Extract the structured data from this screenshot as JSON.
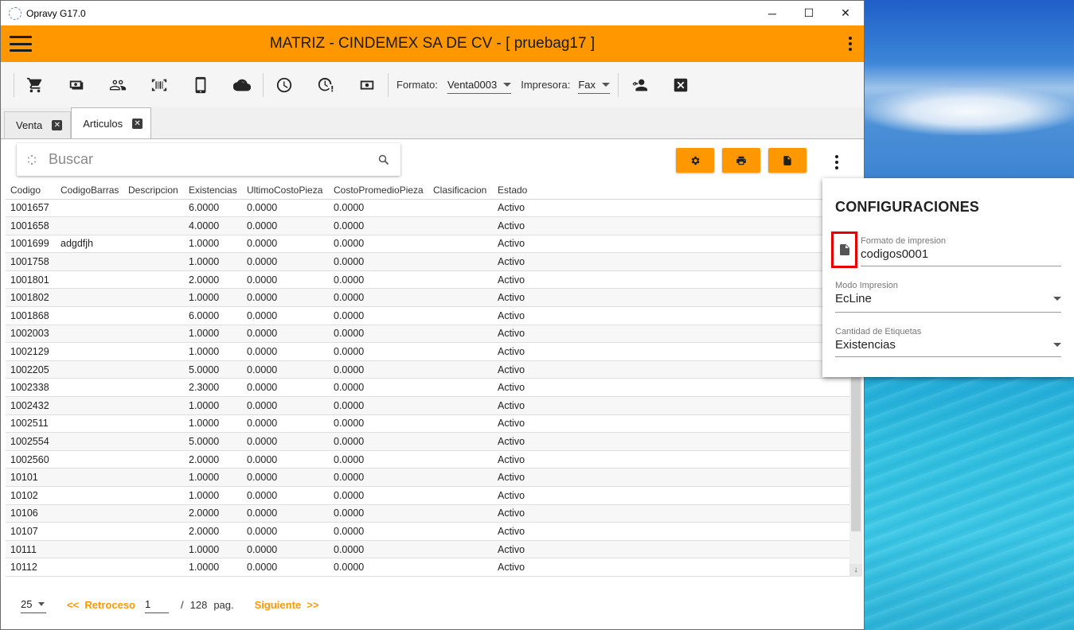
{
  "window": {
    "title": "Opravy G17.0",
    "minimize": "─",
    "maximize": "☐",
    "close": "✕"
  },
  "appbar": {
    "title": "MATRIZ - CINDEMEX SA DE CV - [ pruebag17 ]"
  },
  "toolbar": {
    "icons": [
      "cart-icon",
      "cash-icon",
      "people-icon",
      "barcode-icon",
      "tablet-icon",
      "cloud-sync-icon",
      "clock-icon",
      "clock-alert-icon",
      "money-icon",
      "user-key-icon",
      "close-box-icon"
    ],
    "formato_label": "Formato:",
    "formato_value": "Venta0003",
    "impresora_label": "Impresora:",
    "impresora_value": "Fax"
  },
  "tabs": [
    {
      "label": "Venta",
      "active": false
    },
    {
      "label": "Articulos",
      "active": true
    }
  ],
  "search": {
    "placeholder": "Buscar"
  },
  "table": {
    "headers": [
      "Codigo",
      "CodigoBarras",
      "Descripcion",
      "Existencias",
      "UltimoCostoPieza",
      "CostoPromedioPieza",
      "Clasificacion",
      "Estado"
    ],
    "rows": [
      [
        "1001657",
        "",
        "",
        "6.0000",
        "0.0000",
        "0.0000",
        "",
        "Activo"
      ],
      [
        "1001658",
        "",
        "",
        "4.0000",
        "0.0000",
        "0.0000",
        "",
        "Activo"
      ],
      [
        "1001699",
        "adgdfjh",
        "",
        "1.0000",
        "0.0000",
        "0.0000",
        "",
        "Activo"
      ],
      [
        "1001758",
        "",
        "",
        "1.0000",
        "0.0000",
        "0.0000",
        "",
        "Activo"
      ],
      [
        "1001801",
        "",
        "",
        "2.0000",
        "0.0000",
        "0.0000",
        "",
        "Activo"
      ],
      [
        "1001802",
        "",
        "",
        "1.0000",
        "0.0000",
        "0.0000",
        "",
        "Activo"
      ],
      [
        "1001868",
        "",
        "",
        "6.0000",
        "0.0000",
        "0.0000",
        "",
        "Activo"
      ],
      [
        "1002003",
        "",
        "",
        "1.0000",
        "0.0000",
        "0.0000",
        "",
        "Activo"
      ],
      [
        "1002129",
        "",
        "",
        "1.0000",
        "0.0000",
        "0.0000",
        "",
        "Activo"
      ],
      [
        "1002205",
        "",
        "",
        "5.0000",
        "0.0000",
        "0.0000",
        "",
        "Activo"
      ],
      [
        "1002338",
        "",
        "",
        "2.3000",
        "0.0000",
        "0.0000",
        "",
        "Activo"
      ],
      [
        "1002432",
        "",
        "",
        "1.0000",
        "0.0000",
        "0.0000",
        "",
        "Activo"
      ],
      [
        "1002511",
        "",
        "",
        "1.0000",
        "0.0000",
        "0.0000",
        "",
        "Activo"
      ],
      [
        "1002554",
        "",
        "",
        "5.0000",
        "0.0000",
        "0.0000",
        "",
        "Activo"
      ],
      [
        "1002560",
        "",
        "",
        "2.0000",
        "0.0000",
        "0.0000",
        "",
        "Activo"
      ],
      [
        "10101",
        "",
        "",
        "1.0000",
        "0.0000",
        "0.0000",
        "",
        "Activo"
      ],
      [
        "10102",
        "",
        "",
        "1.0000",
        "0.0000",
        "0.0000",
        "",
        "Activo"
      ],
      [
        "10106",
        "",
        "",
        "2.0000",
        "0.0000",
        "0.0000",
        "",
        "Activo"
      ],
      [
        "10107",
        "",
        "",
        "2.0000",
        "0.0000",
        "0.0000",
        "",
        "Activo"
      ],
      [
        "10111",
        "",
        "",
        "1.0000",
        "0.0000",
        "0.0000",
        "",
        "Activo"
      ],
      [
        "10112",
        "",
        "",
        "1.0000",
        "0.0000",
        "0.0000",
        "",
        "Activo"
      ]
    ]
  },
  "pager": {
    "page_size": "25",
    "prev": "<<  Retroceso",
    "page": "1",
    "slash": "/",
    "total": "128",
    "unit": "pag.",
    "next": "Siguiente  >>"
  },
  "config": {
    "title": "CONFIGURACIONES",
    "formato_label": "Formato de impresion",
    "formato_value": "codigos0001",
    "modo_label": "Modo Impresion",
    "modo_value": "EcLine",
    "cantidad_label": "Cantidad de Etiquetas",
    "cantidad_value": "Existencias"
  },
  "colors": {
    "accent": "#ff9800",
    "highlight": "#e60000"
  }
}
